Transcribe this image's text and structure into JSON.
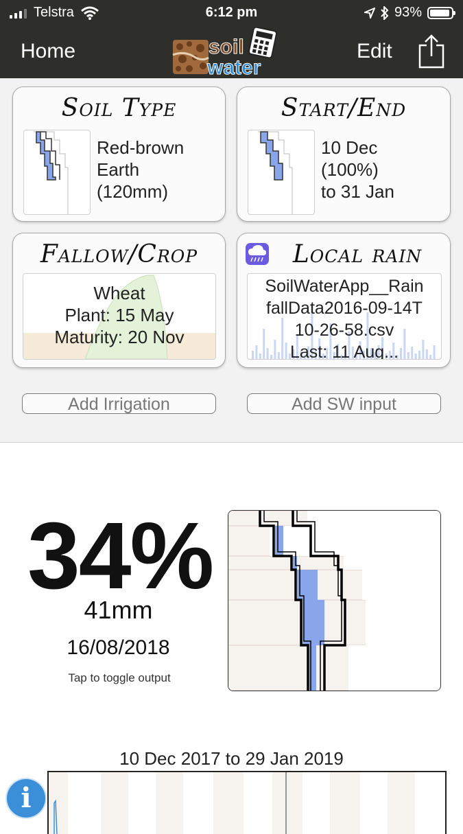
{
  "status_bar": {
    "carrier": "Telstra",
    "time": "6:12 pm",
    "battery": "93%",
    "battery_level": 0.93
  },
  "nav": {
    "home_label": "Home",
    "edit_label": "Edit",
    "logo_line1": "soil",
    "logo_line2": "water"
  },
  "cards": {
    "soil_type": {
      "title": "Soil Type",
      "line1": "Red-brown",
      "line2": "Earth",
      "line3": "(120mm)"
    },
    "start_end": {
      "title": "Start/End",
      "line1": "10 Dec",
      "line2": "(100%)",
      "line3": "to 31 Jan"
    },
    "fallow_crop": {
      "title": "Fallow/Crop",
      "line1": "Wheat",
      "line2": "Plant: 15 May",
      "line3": "Maturity: 20 Nov"
    },
    "local_rain": {
      "title": "Local rain",
      "line1": "SoilWaterApp__Rain",
      "line2": "fallData2016-09-14T",
      "line3": "10-26-58.csv",
      "line4": "Last: 11 Aug..."
    }
  },
  "buttons": {
    "add_irrigation": "Add Irrigation",
    "add_sw_input": "Add SW input"
  },
  "output": {
    "percent": "34%",
    "mm": "41mm",
    "date": "16/08/2018",
    "hint": "Tap to toggle output"
  },
  "timeline": {
    "range": "10 Dec 2017 to 29 Jan 2019"
  },
  "colors": {
    "nav_bg": "#2e2e2b",
    "water_fill": "#8aa6ea",
    "info_blue": "#3a8fd8",
    "rain_icon": "#6a5be0"
  },
  "icons": [
    "signal-icon",
    "wifi-icon",
    "location-icon",
    "bluetooth-icon",
    "battery-icon",
    "share-icon",
    "calculator-icon",
    "rain-cloud-icon",
    "info-icon"
  ]
}
